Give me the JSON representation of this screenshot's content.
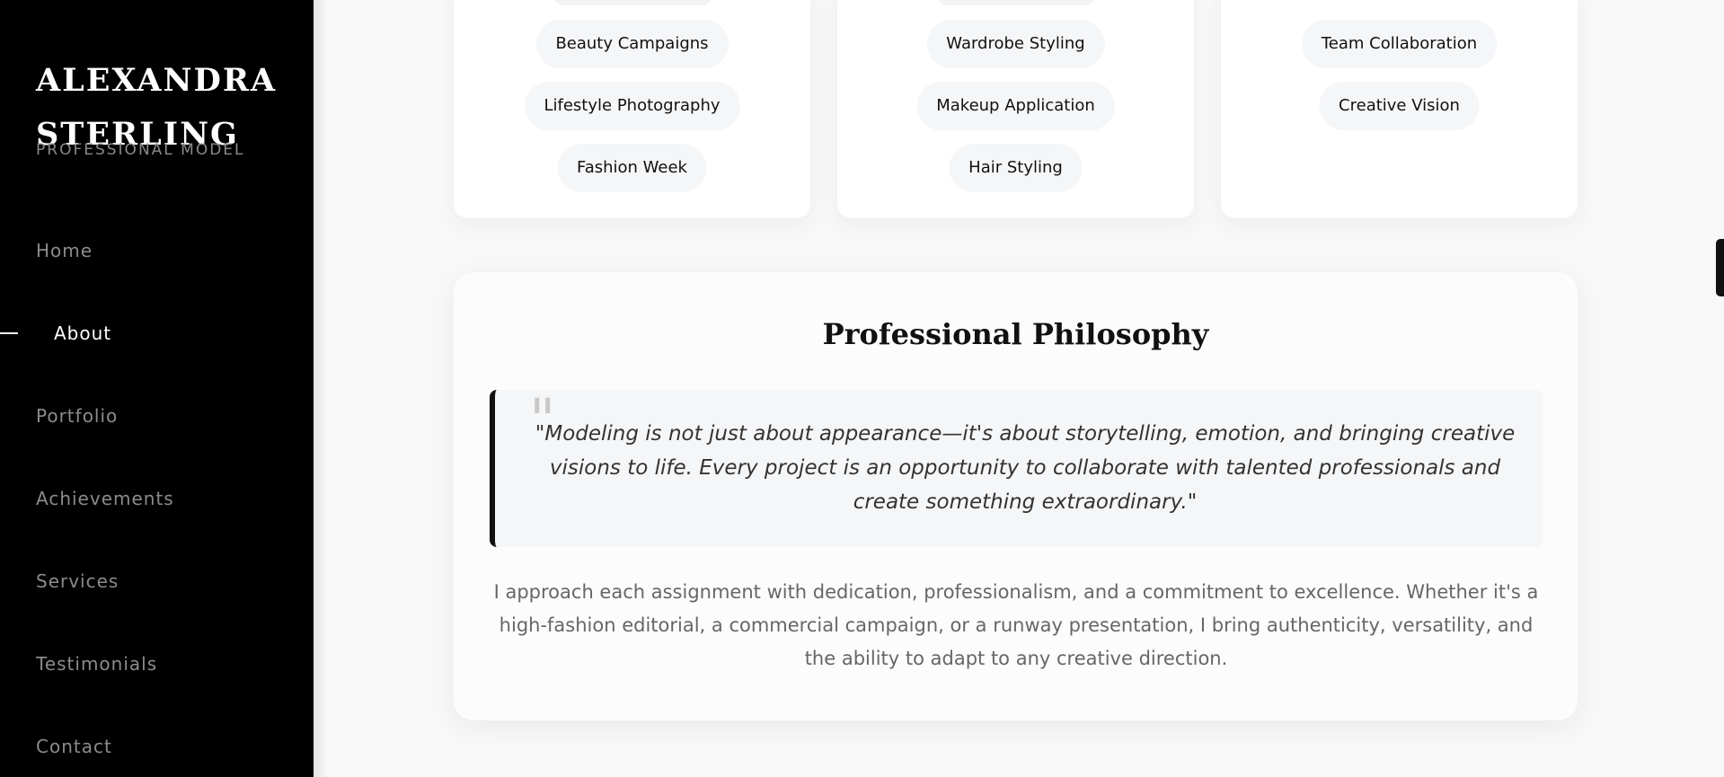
{
  "sidebar": {
    "brand_line1": "ALEXANDRA",
    "brand_line2": "STERLING",
    "subtitle": "PROFESSIONAL MODEL",
    "nav": [
      {
        "label": "Home",
        "active": false
      },
      {
        "label": "About",
        "active": true
      },
      {
        "label": "Portfolio",
        "active": false
      },
      {
        "label": "Achievements",
        "active": false
      },
      {
        "label": "Services",
        "active": false
      },
      {
        "label": "Testimonials",
        "active": false
      },
      {
        "label": "Contact",
        "active": false
      }
    ]
  },
  "skills": {
    "col1": [
      "Beauty Campaigns",
      "Lifestyle Photography",
      "Fashion Week"
    ],
    "col2": [
      "Wardrobe Styling",
      "Makeup Application",
      "Hair Styling"
    ],
    "col3": [
      "Team Collaboration",
      "Creative Vision"
    ]
  },
  "philosophy": {
    "title": "Professional Philosophy",
    "quote_mark": "\"",
    "quote": "\"Modeling is not just about appearance—it's about storytelling, emotion, and bringing creative visions to life. Every project is an opportunity to collaborate with talented professionals and create something extraordinary.\"",
    "body": "I approach each assignment with dedication, professionalism, and a commitment to excellence. Whether it's a high-fashion editorial, a commercial campaign, or a runway presentation, I bring authenticity, versatility, and the ability to adapt to any creative direction."
  },
  "colors": {
    "sidebar_bg": "#000000",
    "accent": "#111111",
    "page_bg": "#f8f8f9"
  }
}
